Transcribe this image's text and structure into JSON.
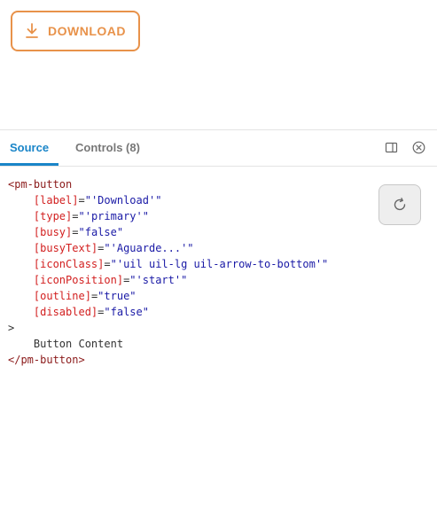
{
  "preview": {
    "button_label": "DOWNLOAD",
    "accent_color": "#e8924a",
    "button_icon": "arrow-to-bottom-icon"
  },
  "tabs": {
    "source": "Source",
    "controls": "Controls (8)"
  },
  "toolbar_icons": [
    "panel-toggle-icon",
    "close-icon"
  ],
  "code": {
    "open_tag": "<pm-button",
    "attrs": [
      {
        "name": "[label]",
        "value": "\"'Download'\""
      },
      {
        "name": "[type]",
        "value": "\"'primary'\""
      },
      {
        "name": "[busy]",
        "value": "\"false\""
      },
      {
        "name": "[busyText]",
        "value": "\"'Aguarde...'\""
      },
      {
        "name": "[iconClass]",
        "value": "\"'uil uil-lg uil-arrow-to-bottom'\""
      },
      {
        "name": "[iconPosition]",
        "value": "\"'start'\""
      },
      {
        "name": "[outline]",
        "value": "\"true\""
      },
      {
        "name": "[disabled]",
        "value": "\"false\""
      }
    ],
    "equals": "=",
    "open_close": ">",
    "content": "    Button Content",
    "close_tag": "</pm-button>"
  },
  "copy_button_icon": "refresh-icon"
}
